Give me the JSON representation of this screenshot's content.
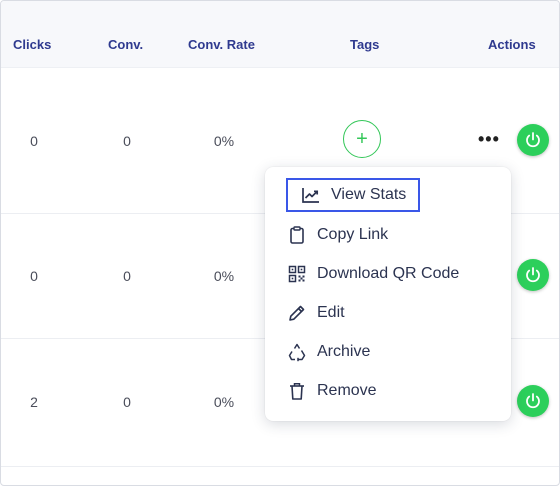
{
  "header": {
    "clicks": "Clicks",
    "conv": "Conv.",
    "conv_rate": "Conv. Rate",
    "tags": "Tags",
    "actions": "Actions"
  },
  "rows": [
    {
      "clicks": "0",
      "conv": "0",
      "conv_rate": "0%"
    },
    {
      "clicks": "0",
      "conv": "0",
      "conv_rate": "0%"
    },
    {
      "clicks": "2",
      "conv": "0",
      "conv_rate": "0%"
    }
  ],
  "add_tag_label": "+",
  "more_label": "•••",
  "menu": {
    "items": [
      {
        "label": "View Stats",
        "icon": "chart-line-icon"
      },
      {
        "label": "Copy Link",
        "icon": "clipboard-icon"
      },
      {
        "label": "Download QR Code",
        "icon": "qr-code-icon"
      },
      {
        "label": "Edit",
        "icon": "pencil-icon"
      },
      {
        "label": "Archive",
        "icon": "recycle-icon"
      },
      {
        "label": "Remove",
        "icon": "trash-icon"
      }
    ]
  },
  "colors": {
    "header_text": "#2f3a8f",
    "accent_green": "#2ccf5b",
    "focus_blue": "#3a57e8"
  }
}
